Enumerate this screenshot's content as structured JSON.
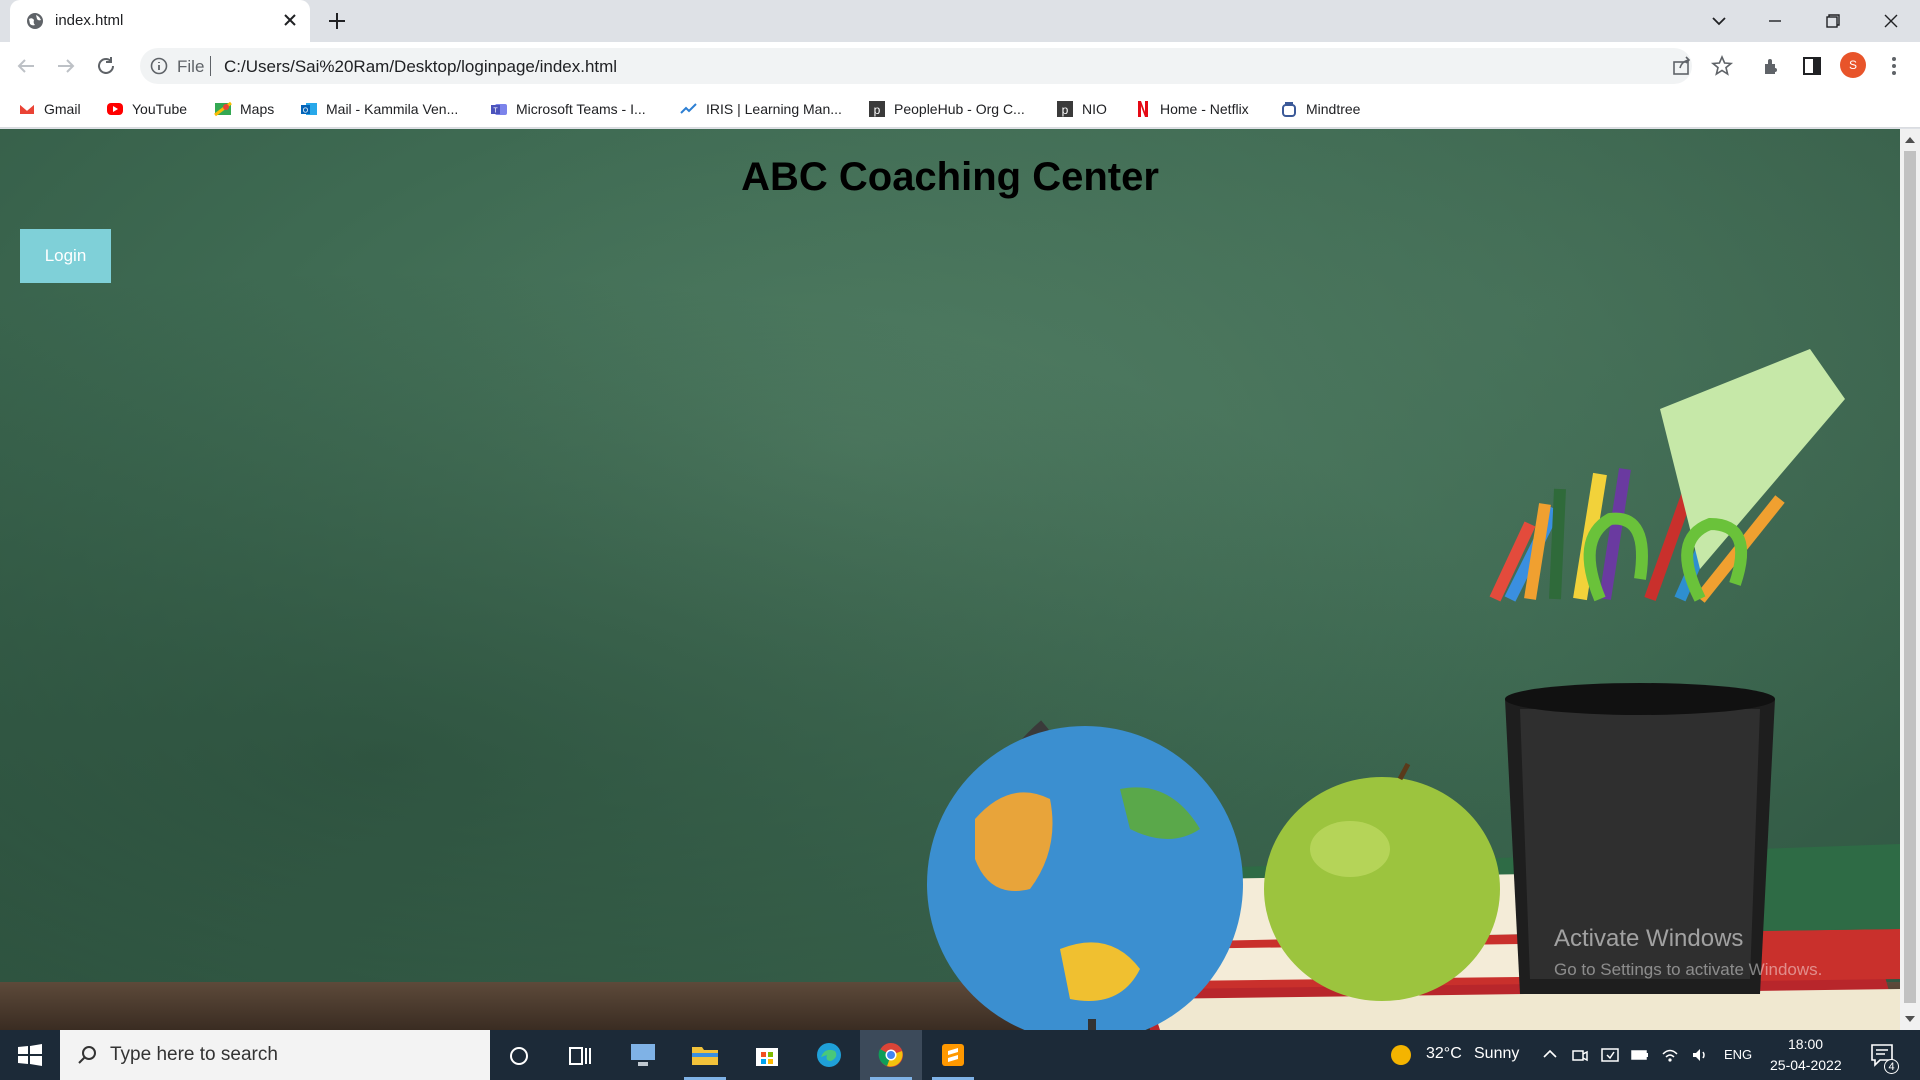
{
  "browser": {
    "tab": {
      "title": "index.html"
    },
    "omnibox": {
      "scheme": "File",
      "url": "C:/Users/Sai%20Ram/Desktop/loginpage/index.html"
    },
    "profile_initial": "S",
    "bookmarks": [
      {
        "label": "Gmail",
        "icon": "gmail-icon"
      },
      {
        "label": "YouTube",
        "icon": "youtube-icon"
      },
      {
        "label": "Maps",
        "icon": "maps-icon"
      },
      {
        "label": "Mail - Kammila Ven...",
        "icon": "outlook-icon"
      },
      {
        "label": "Microsoft Teams - I...",
        "icon": "teams-icon"
      },
      {
        "label": "IRIS | Learning Man...",
        "icon": "iris-icon"
      },
      {
        "label": "PeopleHub - Org C...",
        "icon": "peoplehub-icon"
      },
      {
        "label": "NIO",
        "icon": "nio-icon"
      },
      {
        "label": "Home - Netflix",
        "icon": "netflix-icon"
      },
      {
        "label": "Mindtree",
        "icon": "mindtree-icon"
      }
    ]
  },
  "page": {
    "title": "ABC Coaching Center",
    "login_label": "Login",
    "watermark": {
      "title": "Activate Windows",
      "subtitle": "Go to Settings to activate Windows."
    }
  },
  "taskbar": {
    "search_placeholder": "Type here to search",
    "weather": {
      "temp": "32°C",
      "condition": "Sunny"
    },
    "language": "ENG",
    "time": "18:00",
    "date": "25-04-2022",
    "notification_count": "4"
  },
  "colors": {
    "chalkboard": "#3e6a52",
    "login_button": "#7fd0d8",
    "taskbar": "#1c2a38",
    "profile": "#e8542a"
  }
}
